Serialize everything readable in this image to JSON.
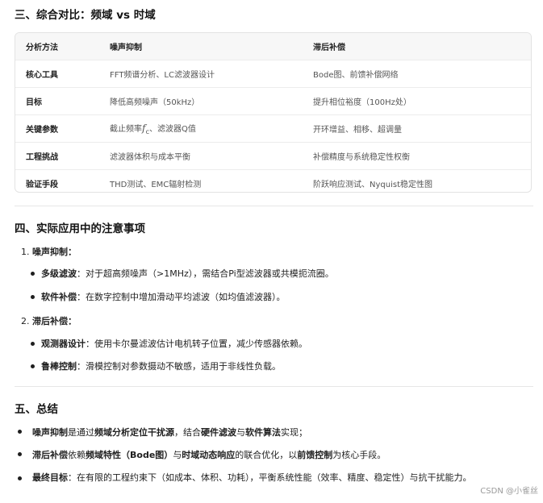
{
  "section3": {
    "title": "三、综合对比：频域 vs 时域",
    "headers": [
      "分析方法",
      "噪声抑制",
      "滞后补偿"
    ],
    "rows": [
      [
        "核心工具",
        "FFT频谱分析、LC滤波器设计",
        "Bode图、前馈补偿网络"
      ],
      [
        "目标",
        "降低高频噪声（50kHz）",
        "提升相位裕度（100Hz处）"
      ],
      [
        "关键参数",
        "截止频率",
        "开环增益、相移、超调量"
      ],
      [
        "工程挑战",
        "滤波器体积与成本平衡",
        "补偿精度与系统稳定性权衡"
      ],
      [
        "验证手段",
        "THD测试、EMC辐射检测",
        "阶跃响应测试、Nyquist稳定性图"
      ]
    ],
    "cutoff": {
      "prefix": "截止频率",
      "symbol": "f",
      "sub": "c",
      "suffix": "、滤波器Q值"
    }
  },
  "section4": {
    "title": "四、实际应用中的注意事项",
    "items": [
      {
        "num": "1.",
        "label": "噪声抑制",
        "subs": [
          {
            "bold": "多级滤波",
            "text": "：对于超高频噪声（>1MHz），需结合Pi型滤波器或共模扼流圈。"
          },
          {
            "bold": "软件补偿",
            "text": "：在数字控制中增加滑动平均滤波（如均值滤波器）。"
          }
        ]
      },
      {
        "num": "2.",
        "label": "滞后补偿",
        "subs": [
          {
            "bold": "观测器设计",
            "text": "：使用卡尔曼滤波估计电机转子位置，减少传感器依赖。"
          },
          {
            "bold": "鲁棒控制",
            "text": "：滑模控制对参数摄动不敏感，适用于非线性负载。"
          }
        ]
      }
    ]
  },
  "section5": {
    "title": "五、总结",
    "b1": {
      "p1": "噪声抑制",
      "p2": "是通过",
      "p3": "频域分析定位干扰源",
      "p4": "，结合",
      "p5": "硬件滤波",
      "p6": "与",
      "p7": "软件算法",
      "p8": "实现；"
    },
    "b2": {
      "p1": "滞后补偿",
      "p2": "依赖",
      "p3": "频域特性（Bode图）",
      "p4": "与",
      "p5": "时域动态响应",
      "p6": "的联合优化，以",
      "p7": "前馈控制",
      "p8": "为核心手段。"
    },
    "b3": {
      "p1": "最终目标",
      "p2": "：在有限的工程约束下（如成本、体积、功耗），平衡系统性能（效率、精度、稳定性）与抗干扰能力。"
    }
  },
  "watermark": "CSDN @小雀丝"
}
